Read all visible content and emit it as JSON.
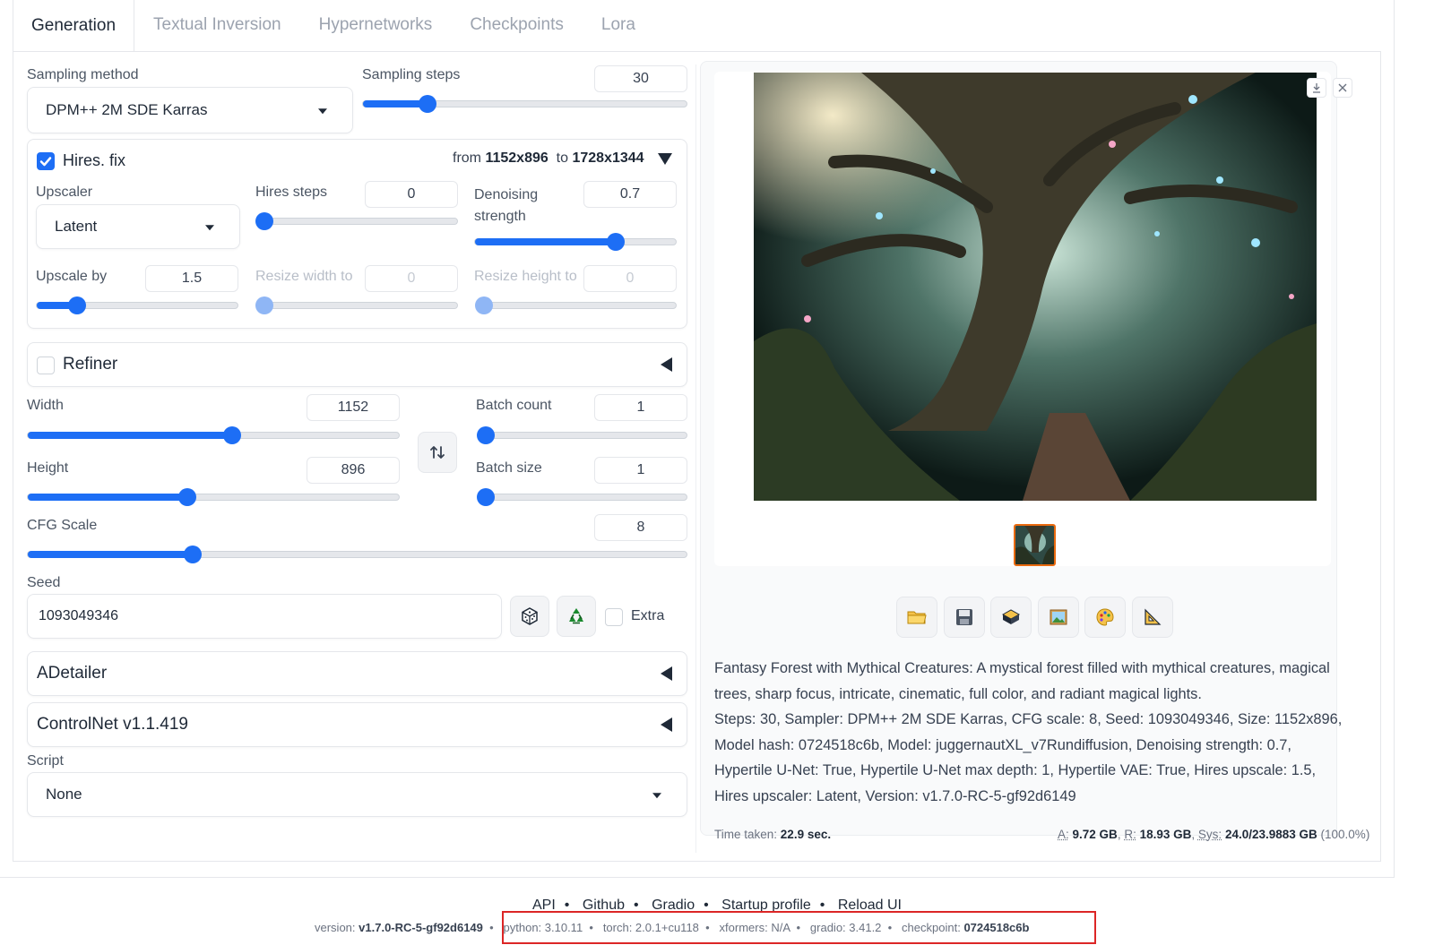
{
  "tabs": [
    "Generation",
    "Textual Inversion",
    "Hypernetworks",
    "Checkpoints",
    "Lora"
  ],
  "sampling": {
    "method_label": "Sampling method",
    "method_value": "DPM++ 2M SDE Karras",
    "steps_label": "Sampling steps",
    "steps_value": "30",
    "steps_fraction": 0.2
  },
  "hires": {
    "label": "Hires. fix",
    "checked": true,
    "from_text": "from",
    "from_size": "1152x896",
    "to_text": "to",
    "to_size": "1728x1344",
    "upscaler_label": "Upscaler",
    "upscaler_value": "Latent",
    "steps_label": "Hires steps",
    "steps_value": "0",
    "denoise_label": "Denoising strength",
    "denoise_value": "0.7",
    "upscale_by_label": "Upscale by",
    "upscale_by_value": "1.5",
    "resize_w_label": "Resize width to",
    "resize_w_value": "0",
    "resize_h_label": "Resize height to",
    "resize_h_value": "0"
  },
  "refiner": {
    "label": "Refiner",
    "checked": false
  },
  "size": {
    "width_label": "Width",
    "width_value": "1152",
    "height_label": "Height",
    "height_value": "896",
    "swap_icon": "swap-vertical-icon",
    "batch_count_label": "Batch count",
    "batch_count_value": "1",
    "batch_size_label": "Batch size",
    "batch_size_value": "1"
  },
  "cfg": {
    "label": "CFG Scale",
    "value": "8"
  },
  "seed": {
    "label": "Seed",
    "value": "1093049346",
    "extra_label": "Extra"
  },
  "accordions": {
    "adetailer": "ADetailer",
    "controlnet": "ControlNet v1.1.419"
  },
  "script": {
    "label": "Script",
    "value": "None"
  },
  "output": {
    "tool_icons": [
      "folder-icon",
      "save-icon",
      "zip-icon",
      "image-icon",
      "palette-icon",
      "ruler-icon"
    ],
    "info_prompt": "Fantasy Forest with Mythical Creatures: A mystical forest filled with mythical creatures, magical trees, sharp focus, intricate, cinematic, full color, and radiant magical lights.",
    "info_params": "Steps: 30, Sampler: DPM++ 2M SDE Karras, CFG scale: 8, Seed: 1093049346, Size: 1152x896, Model hash: 0724518c6b, Model: juggernautXL_v7Rundiffusion, Denoising strength: 0.7, Hypertile U-Net: True, Hypertile U-Net max depth: 1, Hypertile VAE: True, Hires upscale: 1.5, Hires upscaler: Latent, Version: v1.7.0-RC-5-gf92d6149",
    "time_label": "Time taken:",
    "time_value": "22.9 sec.",
    "mem_a_label": "A:",
    "mem_a_value": "9.72 GB",
    "mem_r_label": "R:",
    "mem_r_value": "18.93 GB",
    "mem_sys_label": "Sys:",
    "mem_sys_value": "24.0/23.9883 GB",
    "mem_pct": "(100.0%)"
  },
  "footer": {
    "links": [
      "API",
      "Github",
      "Gradio",
      "Startup profile",
      "Reload UI"
    ],
    "version_label": "version:",
    "version_value": "v1.7.0-RC-5-gf92d6149",
    "python": "python: 3.10.11",
    "torch": "torch: 2.0.1+cu118",
    "xformers": "xformers: N/A",
    "gradio": "gradio: 3.41.2",
    "checkpoint_label": "checkpoint:",
    "checkpoint_value": "0724518c6b"
  },
  "colors": {
    "accent": "#1d6ef5",
    "highlight_box": "#dc2626",
    "thumb_border": "#ea6a0f"
  },
  "sliders": {
    "sampling_steps": 0.2,
    "hires_steps": 0.0,
    "denoising": 0.7,
    "upscale_by": 0.2,
    "resize_w": 0.0,
    "resize_h": 0.0,
    "width": 0.55,
    "height": 0.43,
    "batch_count": 0.0,
    "batch_size": 0.0,
    "cfg": 0.25
  }
}
